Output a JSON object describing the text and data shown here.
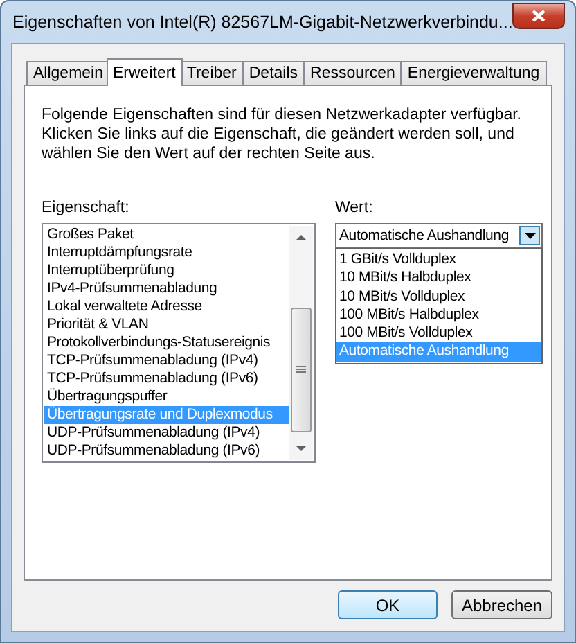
{
  "window": {
    "title": "Eigenschaften von Intel(R) 82567LM-Gigabit-Netzwerkverbindu..."
  },
  "tabs": [
    {
      "label": "Allgemein",
      "selected": false
    },
    {
      "label": "Erweitert",
      "selected": true
    },
    {
      "label": "Treiber",
      "selected": false
    },
    {
      "label": "Details",
      "selected": false
    },
    {
      "label": "Ressourcen",
      "selected": false
    },
    {
      "label": "Energieverwaltung",
      "selected": false
    }
  ],
  "description": "Folgende Eigenschaften sind für diesen Netzwerkadapter verfügbar. Klicken Sie links auf die Eigenschaft, die geändert werden soll, und wählen Sie den Wert auf der rechten Seite aus.",
  "property_label": "Eigenschaft:",
  "properties": [
    {
      "label": "Großes Paket",
      "selected": false
    },
    {
      "label": "Interruptdämpfungsrate",
      "selected": false
    },
    {
      "label": "Interruptüberprüfung",
      "selected": false
    },
    {
      "label": "IPv4-Prüfsummenabladung",
      "selected": false
    },
    {
      "label": "Lokal verwaltete Adresse",
      "selected": false
    },
    {
      "label": "Priorität & VLAN",
      "selected": false
    },
    {
      "label": "Protokollverbindungs-Statusereignis",
      "selected": false
    },
    {
      "label": "TCP-Prüfsummenabladung (IPv4)",
      "selected": false
    },
    {
      "label": "TCP-Prüfsummenabladung (IPv6)",
      "selected": false
    },
    {
      "label": "Übertragungspuffer",
      "selected": false
    },
    {
      "label": "Übertragungsrate und Duplexmodus",
      "selected": true
    },
    {
      "label": "UDP-Prüfsummenabladung (IPv4)",
      "selected": false
    },
    {
      "label": "UDP-Prüfsummenabladung (IPv6)",
      "selected": false
    }
  ],
  "value_label": "Wert:",
  "value_select": {
    "value": "Automatische Aushandlung",
    "expanded": true
  },
  "value_options": [
    {
      "label": "1 GBit/s Vollduplex",
      "selected": false
    },
    {
      "label": "10 MBit/s Halbduplex",
      "selected": false
    },
    {
      "label": "10 MBit/s Vollduplex",
      "selected": false
    },
    {
      "label": "100 MBit/s Halbduplex",
      "selected": false
    },
    {
      "label": "100 MBit/s Vollduplex",
      "selected": false
    },
    {
      "label": "Automatische Aushandlung",
      "selected": true
    }
  ],
  "buttons": [
    {
      "label": "OK",
      "kind": "default"
    },
    {
      "label": "Abbrechen",
      "kind": "normal"
    }
  ]
}
